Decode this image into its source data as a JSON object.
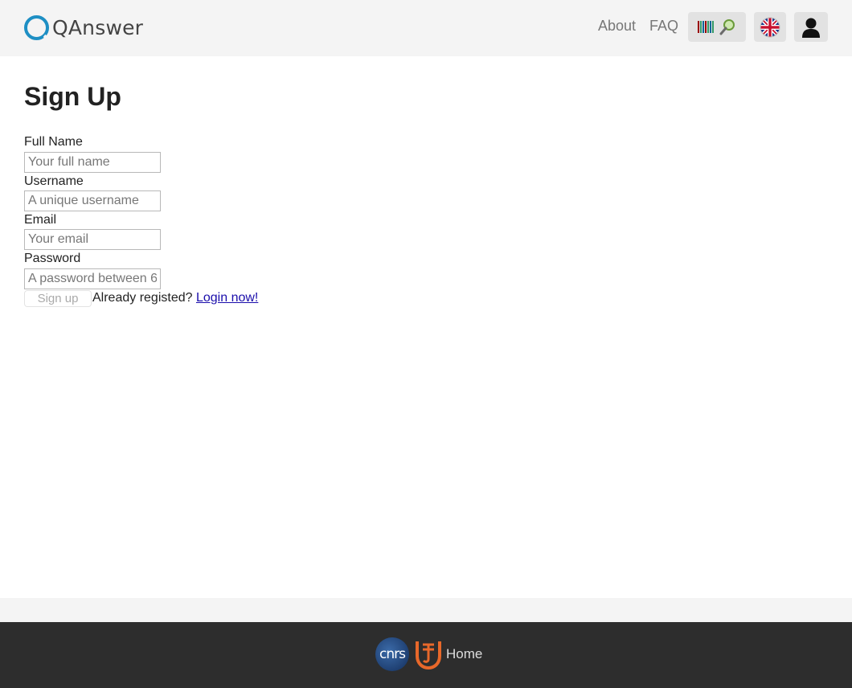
{
  "header": {
    "logo_text": "QAnswer",
    "nav": {
      "about": "About",
      "faq": "FAQ"
    },
    "icons": {
      "wikidata": "wikidata-search-icon",
      "language": "uk-flag-icon",
      "user": "user-icon"
    }
  },
  "main": {
    "title": "Sign Up",
    "fields": {
      "full_name": {
        "label": "Full Name",
        "placeholder": "Your full name"
      },
      "username": {
        "label": "Username",
        "placeholder": "A unique username"
      },
      "email": {
        "label": "Email",
        "placeholder": "Your email"
      },
      "password": {
        "label": "Password",
        "placeholder": "A password between 6"
      }
    },
    "signup_button": "Sign up",
    "already_text": "Already registed?",
    "login_link": "Login now!"
  },
  "footer": {
    "cnrs_text": "cnrs",
    "home_link": "Home"
  },
  "colors": {
    "brand": "#1e8fc4",
    "topbar_bg": "#f4f4f4",
    "footer_bg": "#2d2d2d",
    "link": "#1a0dab"
  }
}
